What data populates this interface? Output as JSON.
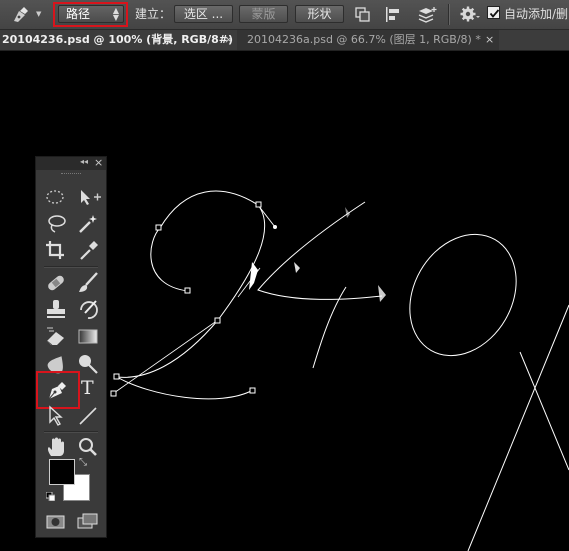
{
  "options_bar": {
    "tool_icon": "pen-tool-icon",
    "mode_select": {
      "value": "路径",
      "highlighted": true
    },
    "make_label": "建立：",
    "selection_button": "选区 ...",
    "mask_button": "蒙版",
    "shape_button": "形状",
    "path_operations_icon": "path-operations-icon",
    "path_alignment_icon": "path-alignment-icon",
    "path_arrangement_icon": "path-arrangement-icon",
    "settings_icon": "gear-icon",
    "auto_add_delete": {
      "label": "自动添加/删",
      "checked": true
    }
  },
  "tabs": [
    {
      "label": "20104236.psd @ 100% (背景, RGB/8#) *",
      "active": true,
      "close": "×"
    },
    {
      "label": "20104236a.psd @ 66.7% (图层 1, RGB/8) *",
      "active": false,
      "close": "×"
    }
  ],
  "tool_panel": {
    "collapse_icon": "double-chevron-left-icon",
    "close_icon": "close-icon",
    "grip_icon": "grip-icon",
    "tools": [
      "elliptical-marquee-icon",
      "move-tool-icon",
      "lasso-icon",
      "magic-wand-icon",
      "crop-icon",
      "eyedropper-icon",
      "healing-brush-icon",
      "brush-icon",
      "clone-stamp-icon",
      "history-brush-icon",
      "eraser-icon",
      "gradient-icon",
      "blur-icon",
      "dodge-icon",
      "pen-tool-icon",
      "type-tool-icon",
      "path-selection-icon",
      "line-tool-icon",
      "hand-tool-icon",
      "zoom-tool-icon"
    ],
    "type_tool_glyph": "T",
    "active_tool": "pen-tool-icon",
    "foreground_color": "#000000",
    "background_color": "#ffffff",
    "quick_mask_icon": "quick-mask-icon",
    "screen_mode_icon": "screen-mode-icon"
  },
  "canvas": {
    "background": "#000000",
    "path_color": "#ffffff",
    "highlight_color": "#d8141c"
  }
}
